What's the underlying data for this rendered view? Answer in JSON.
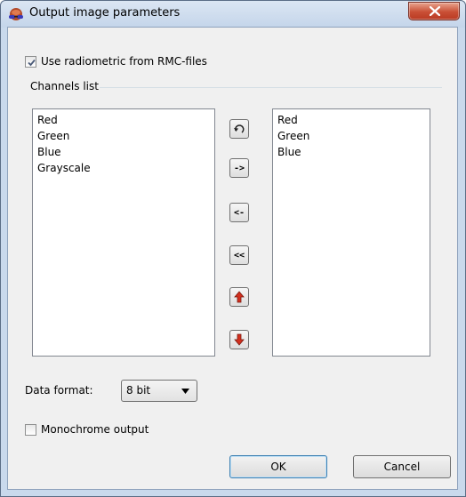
{
  "dialog": {
    "title": "Output image parameters",
    "use_radiometric_label": "Use radiometric from RMC-files",
    "use_radiometric_checked": true,
    "channels_group_label": "Channels list",
    "available_channels": [
      "Red",
      "Green",
      "Blue",
      "Grayscale"
    ],
    "selected_channels": [
      "Red",
      "Green",
      "Blue"
    ],
    "transfer_buttons": {
      "reset_icon": "undo-arrow-icon",
      "add_label": "->",
      "remove_label": "<-",
      "remove_all_label": "<<",
      "up_icon": "arrow-up-icon",
      "down_icon": "arrow-down-icon"
    },
    "data_format_label": "Data format:",
    "data_format_value": "8 bit",
    "monochrome_label": "Monochrome output",
    "monochrome_checked": false,
    "ok_label": "OK",
    "cancel_label": "Cancel"
  },
  "colors": {
    "titlebar": "#c4d5ea",
    "close_button": "#c94f35",
    "arrow_red": "#d32f1e"
  }
}
